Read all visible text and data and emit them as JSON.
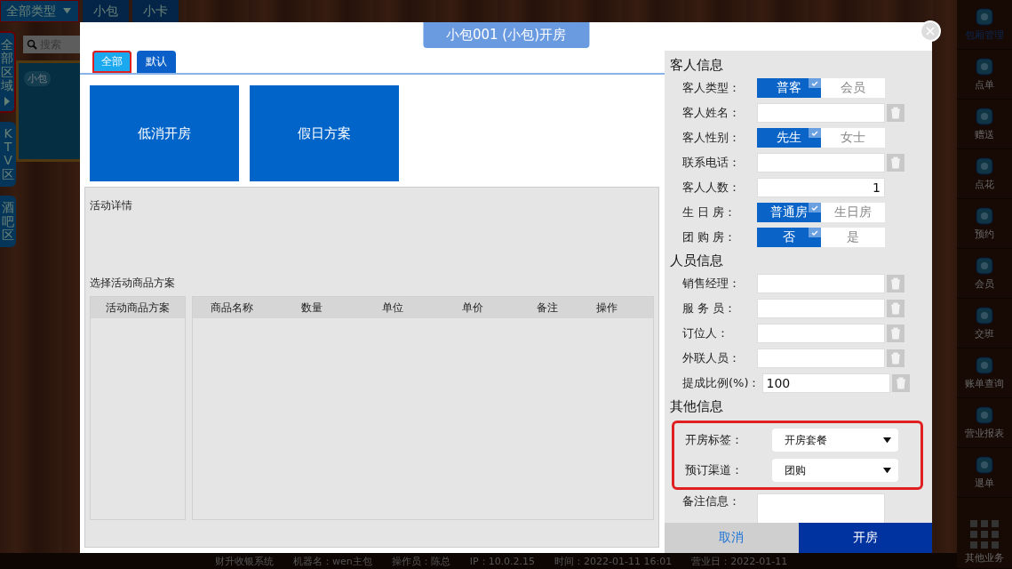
{
  "top_bar": {
    "type_filter": {
      "label": "全部类型"
    },
    "tabs": [
      {
        "label": "小包",
        "selected": false
      },
      {
        "label": "小卡",
        "selected": false
      }
    ]
  },
  "area_tabs": [
    {
      "label": "全部区域",
      "selected": true
    },
    {
      "label": "KTV区",
      "selected": false
    },
    {
      "label": "酒吧区",
      "selected": false
    }
  ],
  "search": {
    "placeholder": "搜索"
  },
  "rooms": [
    {
      "name": "小包"
    }
  ],
  "sidebar": {
    "items": [
      {
        "label": "包厢管理",
        "kind": "tile",
        "selected": true
      },
      {
        "label": "点单",
        "kind": "tile",
        "selected": false
      },
      {
        "label": "赠送",
        "kind": "tile",
        "selected": false
      },
      {
        "label": "点花",
        "kind": "tile",
        "selected": false
      },
      {
        "label": "预约",
        "kind": "tile",
        "selected": false
      },
      {
        "label": "会员",
        "kind": "tile",
        "selected": false
      },
      {
        "label": "交班",
        "kind": "tile",
        "selected": false
      },
      {
        "label": "账单查询",
        "kind": "tile",
        "selected": false
      },
      {
        "label": "营业报表",
        "kind": "tile",
        "selected": false
      },
      {
        "label": "退单",
        "kind": "tile",
        "selected": false
      },
      {
        "label": "其他业务",
        "kind": "grid",
        "selected": false
      }
    ]
  },
  "status_bar": [
    "财升收银系统",
    "机器名：wen主包",
    "操作员：陈总",
    "IP：10.0.2.15",
    "时间：2022-01-11 16:01",
    "营业日：2022-01-11"
  ],
  "dialog": {
    "title": "小包001 (小包)开房",
    "tabs": [
      {
        "label": "全部",
        "selected": true
      },
      {
        "label": "默认",
        "selected": false
      }
    ],
    "schemes": [
      "低消开房",
      "假日方案"
    ],
    "detail_label": "活动详情",
    "product_label": "选择活动商品方案",
    "plan_table": {
      "columns": [
        "活动商品方案"
      ]
    },
    "product_table": {
      "columns": [
        "商品名称",
        "数量",
        "单位",
        "单价",
        "备注",
        "操作"
      ]
    },
    "sections": [
      {
        "title": "客人信息",
        "fields": [
          {
            "kind": "toggle",
            "label": "客人类型：",
            "options": [
              {
                "label": "普客",
                "selected": true
              },
              {
                "label": "会员",
                "selected": false
              }
            ]
          },
          {
            "kind": "text",
            "label": "客人姓名：",
            "clearable": true
          },
          {
            "kind": "toggle",
            "label": "客人性别：",
            "options": [
              {
                "label": "先生",
                "selected": true
              },
              {
                "label": "女士",
                "selected": false
              }
            ]
          },
          {
            "kind": "text",
            "label": "联系电话：",
            "clearable": true
          },
          {
            "kind": "number",
            "label": "客人人数：",
            "value": "1",
            "clearable": false
          },
          {
            "kind": "toggle",
            "label": "生 日 房：",
            "options": [
              {
                "label": "普通房",
                "selected": true
              },
              {
                "label": "生日房",
                "selected": false
              }
            ]
          },
          {
            "kind": "toggle",
            "label": "团 购 房：",
            "options": [
              {
                "label": "否",
                "selected": true
              },
              {
                "label": "是",
                "selected": false
              }
            ]
          }
        ]
      },
      {
        "title": "人员信息",
        "fields": [
          {
            "kind": "text",
            "label": "销售经理：",
            "clearable": true
          },
          {
            "kind": "text",
            "label": "服 务 员：",
            "clearable": true
          },
          {
            "kind": "text",
            "label": "订位人：",
            "clearable": true
          },
          {
            "kind": "text",
            "label": "外联人员：",
            "clearable": true
          },
          {
            "kind": "text",
            "label": "提成比例(%)：",
            "value": "100",
            "clearable": true
          }
        ]
      },
      {
        "title": "其他信息",
        "fields": [
          {
            "kind": "group",
            "highlighted": true,
            "fields": [
              {
                "kind": "select",
                "label": "开房标签：",
                "value": "开房套餐"
              },
              {
                "kind": "select",
                "label": "预订渠道：",
                "value": "团购"
              }
            ]
          },
          {
            "kind": "textarea",
            "label": "备注信息："
          }
        ]
      }
    ],
    "buttons": [
      {
        "label": "取消",
        "kind": "secondary"
      },
      {
        "label": "开房",
        "kind": "primary"
      }
    ]
  }
}
